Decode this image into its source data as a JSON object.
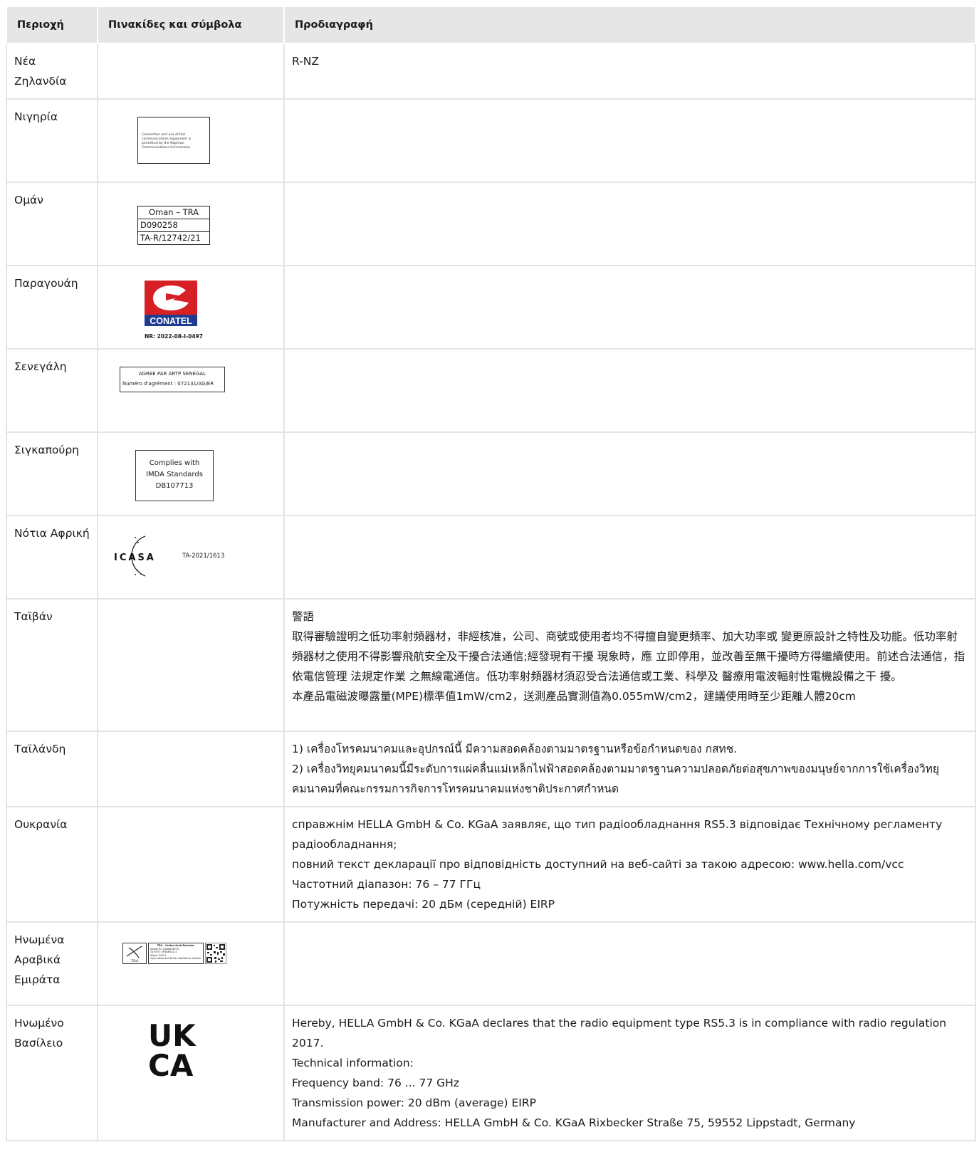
{
  "headers": {
    "region": "Περιοχή",
    "labels": "Πινακίδες και σύμβολα",
    "spec": "Προδιαγραφή"
  },
  "rows": [
    {
      "country": "Νέα Ζηλανδία",
      "spec": [
        "R-NZ"
      ]
    },
    {
      "country": "Νιγηρία",
      "label": {
        "text": "Connection and use of this communications equipment is permitted by the Nigerian Communications Commission"
      },
      "spec": []
    },
    {
      "country": "Ομάν",
      "label": {
        "lines": [
          "Oman – TRA",
          "D090258",
          "TA-R/12742/21"
        ]
      },
      "spec": []
    },
    {
      "country": "Παραγουάη",
      "label": {
        "brand": "CONATEL",
        "number": "NR: 2022-08-I-0497",
        "colors": {
          "red": "#d71f26",
          "blue": "#1f3b8f"
        }
      },
      "spec": []
    },
    {
      "country": "Σενεγάλη",
      "label": {
        "title": "AGREE PAR ARTP SENEGAL",
        "number": "Numéro d'agrément : 072131/AG/ER"
      },
      "spec": []
    },
    {
      "country": "Σιγκαπούρη",
      "label": {
        "lines": [
          "Complies with",
          "IMDA Standards",
          "DB107713"
        ]
      },
      "spec": []
    },
    {
      "country": "Νότια Αφρική",
      "label": {
        "brand": "ICASA",
        "number": "TA-2021/1613"
      },
      "spec": []
    },
    {
      "country": "Ταϊβάν",
      "spec": [
        "警語",
        "取得審驗證明之低功率射頻器材，非經核准，公司、商號或使用者均不得擅自變更頻率、加大功率或 變更原設計之特性及功能。低功率射 頻器材之使用不得影響飛航安全及干擾合法通信;經發現有干擾 現象時，應 立即停用，並改善至無干擾時方得繼續使用。前述合法通信，指依電信管理 法規定作業 之無線電通信。低功率射頻器材須忍受合法通信或工業、科學及 醫療用電波輻射性電機設備之干 擾。",
        "本產品電磁波曝露量(MPE)標準值1mW/cm2，送測產品實測值為0.055mW/cm2，建議使用時至少距離人體20cm"
      ]
    },
    {
      "country": "Ταϊλάνδη",
      "spec": [
        "1) เครื่องโทรคมนาคมและอุปกรณ์นี้ มีความสอดคล้องตามมาตรฐานหรือข้อกำหนดของ กสทช.",
        "2) เครื่องวิทยุคมนาคมนี้มีระดับการแผ่คลื่นแม่เหล็กไฟฟ้าสอดคล้องตามมาตรฐานความปลอดภัยต่อสุขภาพของมนุษย์จากการใช้เครื่องวิทยุคมนาคมที่คณะกรรมการกิจการโทรคมนาคมแห่งชาติประกาศกำหนด"
      ]
    },
    {
      "country": "Ουκρανία",
      "spec": [
        "справжнім HELLA GmbH & Co. KGaA заявляє, що тип радіообладнання RS5.3 відповідає Технічному регламенту радіообладнання;",
        "повний текст декларації про відповідність доступний на веб-сайті за такою адресою: www.hella.com/vcc",
        "Частотний діапазон: 76 – 77 ГГц",
        "Потужність передачі: 20 дБм (середній) EIRP"
      ]
    },
    {
      "country": "Ηνωμένα Αραβικά Εμιράτα",
      "label": {
        "logo_text": "TRA",
        "title": "TRA – United Arab Emirates",
        "lines": [
          "Dealer ID: DA48658715",
          "TA RTTE: ER48892121",
          "Model: RS5.3",
          "Type: Advanced Driver Assistance System"
        ]
      },
      "spec": []
    },
    {
      "country": "Ηνωμένο Βασίλειο",
      "label": {
        "brand_top": "UK",
        "brand_bottom": "CA"
      },
      "spec": [
        "Hereby, HELLA GmbH & Co. KGaA declares that the radio equipment type RS5.3 is in compliance with radio regulation 2017.",
        "Technical information:",
        "Frequency band: 76 ... 77 GHz",
        "Transmission power: 20 dBm (average) EIRP",
        "Manufacturer and Address: HELLA GmbH & Co. KGaA Rixbecker Straße 75, 59552 Lippstadt, Germany"
      ]
    }
  ]
}
